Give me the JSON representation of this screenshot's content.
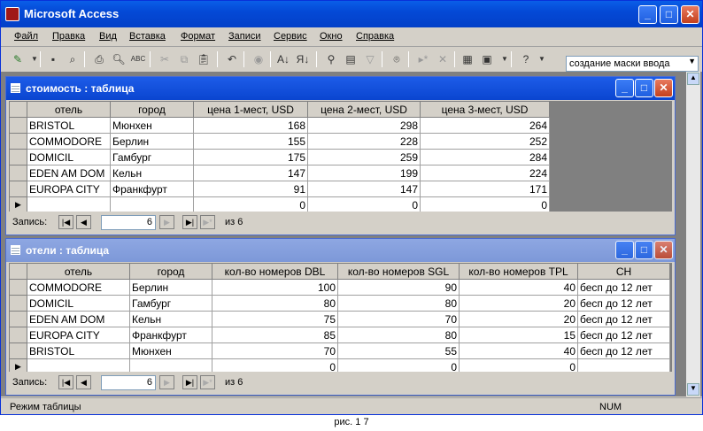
{
  "app": {
    "title": "Microsoft Access"
  },
  "menu": [
    "Файл",
    "Правка",
    "Вид",
    "Вставка",
    "Формат",
    "Записи",
    "Сервис",
    "Окно",
    "Справка"
  ],
  "help_box": {
    "value": "создание маски ввода"
  },
  "window1": {
    "title": "стоимость : таблица",
    "columns": [
      "отель",
      "город",
      "цена 1-мест, USD",
      "цена 2-мест, USD",
      "цена 3-мест, USD"
    ],
    "rows": [
      [
        "BRISTOL",
        "Мюнхен",
        "168",
        "298",
        "264"
      ],
      [
        "COMMODORE",
        "Берлин",
        "155",
        "228",
        "252"
      ],
      [
        "DOMICIL",
        "Гамбург",
        "175",
        "259",
        "284"
      ],
      [
        "EDEN AM DOM",
        "Кельн",
        "147",
        "199",
        "224"
      ],
      [
        "EUROPA CITY",
        "Франкфурт",
        "91",
        "147",
        "171"
      ]
    ],
    "new_row": [
      "",
      "",
      "0",
      "0",
      "0"
    ],
    "nav": {
      "label": "Запись:",
      "current": "6",
      "of": "из 6"
    }
  },
  "window2": {
    "title": "отели : таблица",
    "columns": [
      "отель",
      "город",
      "кол-во номеров DBL",
      "кол-во номеров SGL",
      "кол-во номеров TPL",
      "CH"
    ],
    "rows": [
      [
        "COMMODORE",
        "Берлин",
        "100",
        "90",
        "40",
        "бесп до 12 лет"
      ],
      [
        "DOMICIL",
        "Гамбург",
        "80",
        "80",
        "20",
        "бесп до 12 лет"
      ],
      [
        "EDEN AM DOM",
        "Кельн",
        "75",
        "70",
        "20",
        "бесп до 12 лет"
      ],
      [
        "EUROPA CITY",
        "Франкфурт",
        "85",
        "80",
        "15",
        "бесп до 12 лет"
      ],
      [
        "BRISTOL",
        "Мюнхен",
        "70",
        "55",
        "40",
        "бесп до 12 лет"
      ]
    ],
    "new_row": [
      "",
      "",
      "0",
      "0",
      "0",
      ""
    ],
    "nav": {
      "label": "Запись:",
      "current": "6",
      "of": "из 6"
    }
  },
  "status": {
    "left": "Режим таблицы",
    "num": "NUM"
  },
  "caption": "рис. 1 7"
}
